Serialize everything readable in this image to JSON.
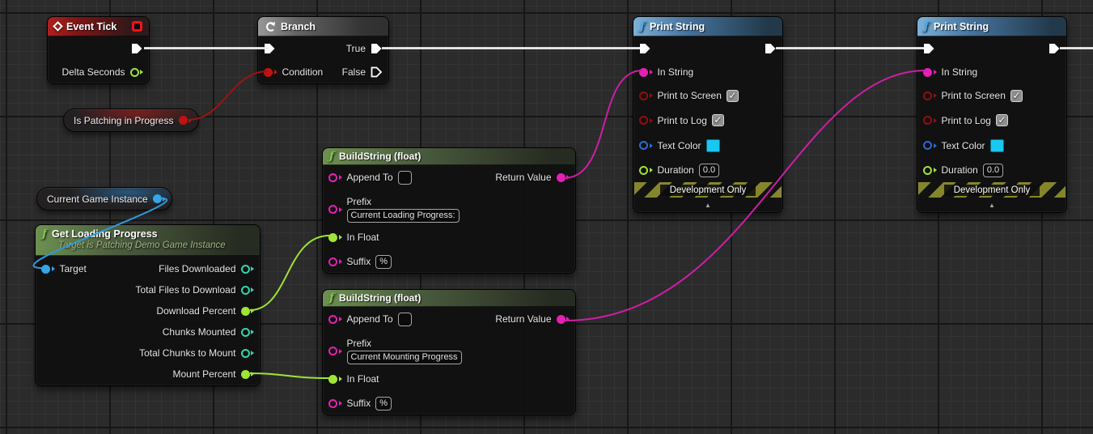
{
  "colors": {
    "wire_exec": "#efefef",
    "wire_bool": "#9e1212",
    "wire_object": "#2e9ae2",
    "wire_float": "#9fe436",
    "wire_string": "#cf1da6",
    "pin_bool": "#920f0f",
    "pin_float": "#9fe436",
    "pin_int": "#34d5ac",
    "pin_string": "#e520b4",
    "pin_object": "#35a5e9",
    "pin_struct": "#2a6cd4",
    "text_color_swatch": "#18c8f0"
  },
  "glyphs": {
    "fn": "ƒ",
    "check": "✓",
    "collapse": "▲"
  },
  "nodes": {
    "event_tick": {
      "title": "Event Tick",
      "delta_seconds_label": "Delta Seconds"
    },
    "branch": {
      "title": "Branch",
      "condition_label": "Condition",
      "true_label": "True",
      "false_label": "False"
    },
    "is_patching": {
      "label": "Is Patching in Progress"
    },
    "current_game_instance": {
      "label": "Current Game Instance"
    },
    "get_loading_progress": {
      "title": "Get Loading Progress",
      "subtitle": "Target is Patching Demo Game Instance",
      "target_label": "Target",
      "outputs": [
        "Files Downloaded",
        "Total Files to Download",
        "Download Percent",
        "Chunks Mounted",
        "Total Chunks to Mount",
        "Mount Percent"
      ]
    },
    "build_string_1": {
      "title": "BuildString (float)",
      "append_to_label": "Append To",
      "append_to_value": "",
      "prefix_label": "Prefix",
      "prefix_value": "Current Loading Progress:",
      "in_float_label": "In Float",
      "suffix_label": "Suffix",
      "suffix_value": "%",
      "return_value_label": "Return Value"
    },
    "build_string_2": {
      "title": "BuildString (float)",
      "append_to_label": "Append To",
      "append_to_value": "",
      "prefix_label": "Prefix",
      "prefix_value": "Current Mounting Progress",
      "in_float_label": "In Float",
      "suffix_label": "Suffix",
      "suffix_value": "%",
      "return_value_label": "Return Value"
    },
    "print_string_1": {
      "title": "Print String",
      "in_string_label": "In String",
      "print_to_screen_label": "Print to Screen",
      "print_to_screen_checked": true,
      "print_to_log_label": "Print to Log",
      "print_to_log_checked": true,
      "text_color_label": "Text Color",
      "duration_label": "Duration",
      "duration_value": "0.0",
      "banner": "Development Only"
    },
    "print_string_2": {
      "title": "Print String",
      "in_string_label": "In String",
      "print_to_screen_label": "Print to Screen",
      "print_to_screen_checked": true,
      "print_to_log_label": "Print to Log",
      "print_to_log_checked": true,
      "text_color_label": "Text Color",
      "duration_label": "Duration",
      "duration_value": "0.0",
      "banner": "Development Only"
    }
  }
}
